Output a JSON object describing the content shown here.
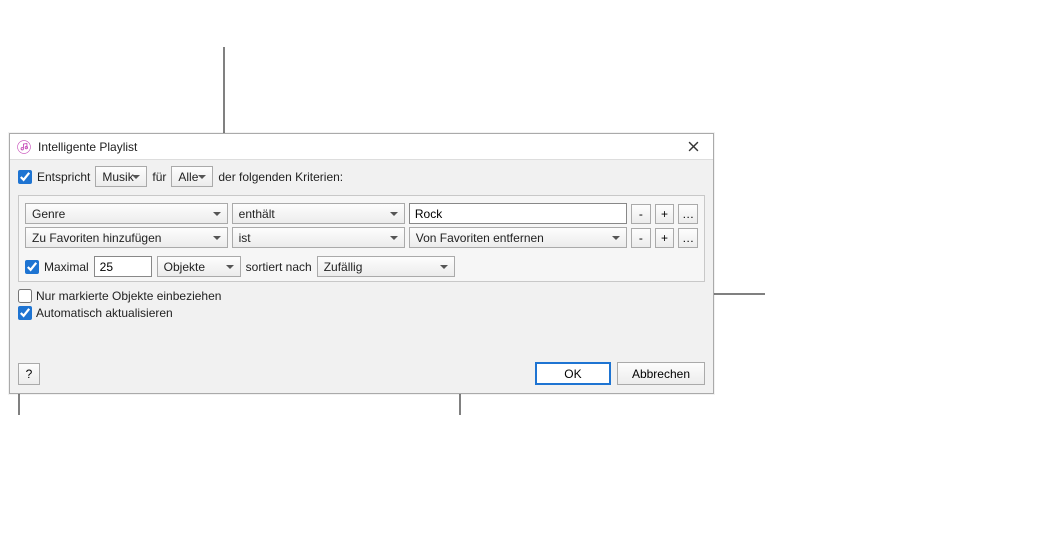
{
  "window": {
    "title": "Intelligente Playlist"
  },
  "match": {
    "label": "Entspricht",
    "source": "Musik",
    "join": "für",
    "scope": "Alle",
    "suffix": "der folgenden Kriterien:",
    "checked": true
  },
  "rules": [
    {
      "field": "Genre",
      "op": "enthält",
      "value": "Rock",
      "value_is_select": false
    },
    {
      "field": "Zu Favoriten hinzufügen",
      "op": "ist",
      "value": "Von Favoriten entfernen",
      "value_is_select": true
    }
  ],
  "rule_buttons": {
    "minus": "-",
    "plus": "+",
    "more": "…"
  },
  "limit": {
    "label": "Maximal",
    "amount": "25",
    "unit": "Objekte",
    "sort_label": "sortiert nach",
    "sort": "Zufällig",
    "checked": true
  },
  "only_checked": {
    "label": "Nur markierte Objekte einbeziehen",
    "checked": false
  },
  "live": {
    "label": "Automatisch aktualisieren",
    "checked": true
  },
  "footer": {
    "help": "?",
    "ok": "OK",
    "cancel": "Abbrechen"
  }
}
